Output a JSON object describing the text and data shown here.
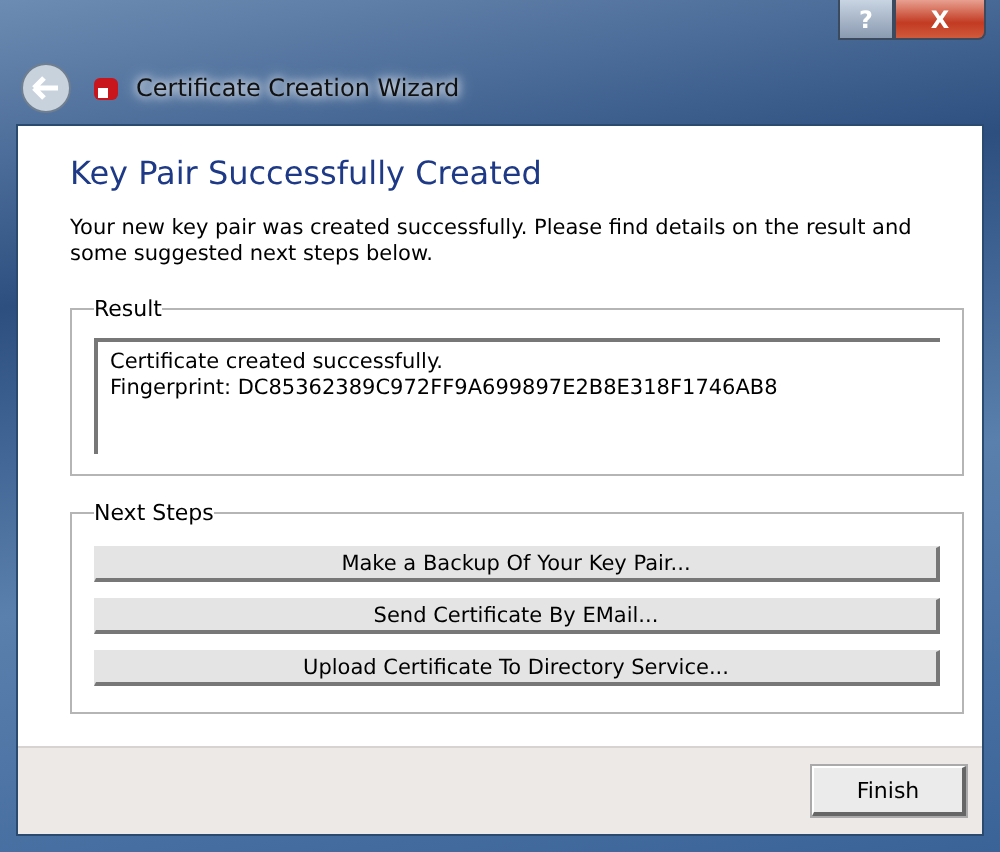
{
  "window": {
    "title": "Certificate Creation Wizard",
    "title_buttons": [
      "?",
      "X"
    ]
  },
  "heading": "Key Pair Successfully Created",
  "intro": "Your new key pair was created successfully. Please find details on the result and some suggested next steps below.",
  "result": {
    "label": "Result",
    "lines": [
      "Certificate created successfully.",
      "Fingerprint: DC85362389C972FF9A699897E2B8E318F1746AB8"
    ]
  },
  "next_steps": {
    "label": "Next Steps",
    "buttons": [
      "Make a Backup Of Your Key Pair...",
      "Send Certificate By EMail...",
      "Upload Certificate To Directory Service..."
    ]
  },
  "buttons": [
    "Finish"
  ]
}
